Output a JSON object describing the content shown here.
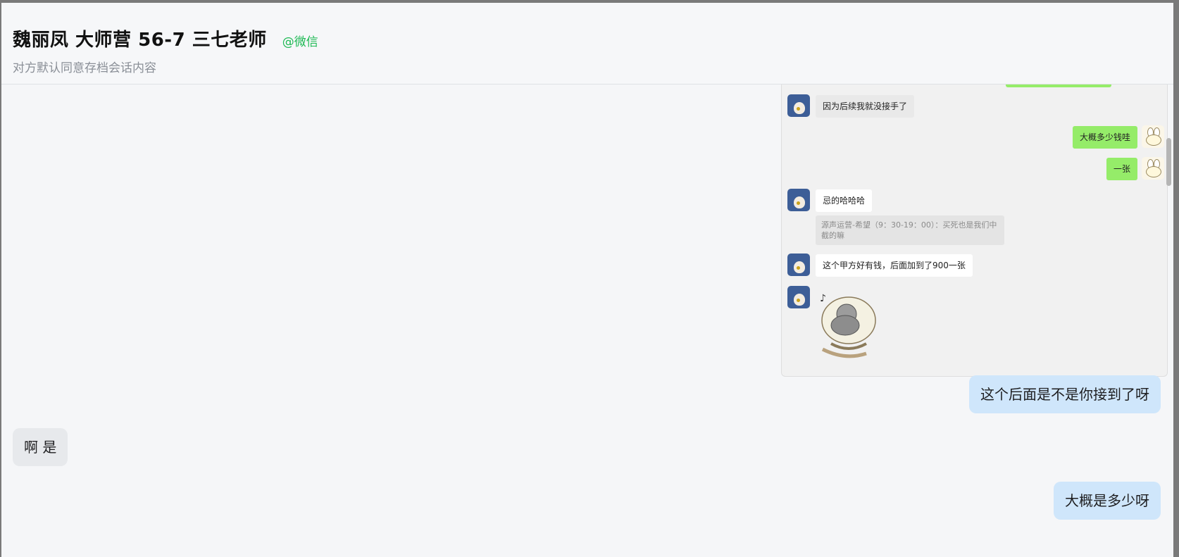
{
  "conversation": {
    "title": "魏丽凤 大师营 56-7 三七老师",
    "platform": "@微信",
    "subtitle": "对方默认同意存档会话内容"
  },
  "screenshot_messages": [
    {
      "side": "left",
      "style": "gray",
      "text": "因为后续我就没接手了"
    },
    {
      "side": "right",
      "style": "green",
      "text": "大概多少钱哇"
    },
    {
      "side": "right",
      "style": "green",
      "text": "一张"
    },
    {
      "side": "left",
      "style": "white",
      "text": "忌的哈哈哈"
    },
    {
      "side": "left",
      "style": "quote",
      "text": "源声运营-希望（9：30-19：00）：买死也是我们中\n截的嘛"
    },
    {
      "side": "left",
      "style": "white",
      "text": "这个甲方好有钱，后面加到了900一张"
    },
    {
      "side": "left",
      "style": "sticker",
      "text": ""
    }
  ],
  "messages": [
    {
      "direction": "outgoing",
      "text": "这个后面是不是你接到了呀"
    },
    {
      "direction": "incoming",
      "text": "啊 是"
    },
    {
      "direction": "outgoing",
      "text": "大概是多少呀"
    }
  ],
  "colors": {
    "outgoing_bubble": "#cfe6fb",
    "incoming_bubble": "#e7e9ec",
    "platform": "#1db954",
    "wechat_green": "#95ec69"
  }
}
